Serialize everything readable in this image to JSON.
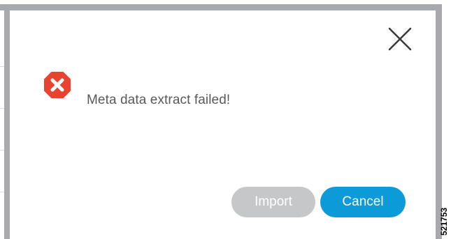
{
  "dialog": {
    "message": "Meta data extract failed!",
    "status_icon": "error-octagon-icon",
    "close_icon": "close-icon"
  },
  "buttons": {
    "import_label": "Import",
    "import_enabled": false,
    "cancel_label": "Cancel",
    "cancel_enabled": true
  },
  "figure_id": "521753",
  "colors": {
    "error_red": "#e8432f",
    "cancel_blue": "#0c9bd8",
    "disabled_gray": "#c6c7c8",
    "frame_gray": "#a7a9ac",
    "text_gray": "#58595b"
  }
}
